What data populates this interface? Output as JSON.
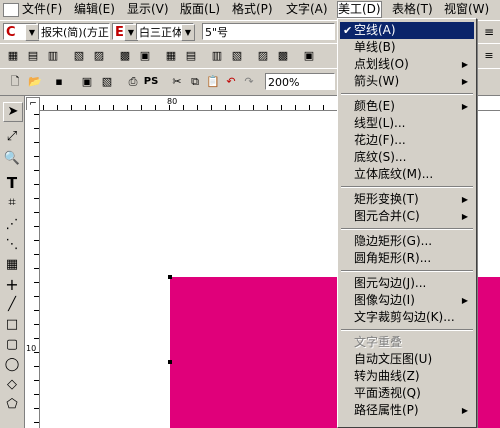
{
  "menubar": {
    "items": [
      {
        "label": "文件(F)"
      },
      {
        "label": "编辑(E)"
      },
      {
        "label": "显示(V)"
      },
      {
        "label": "版面(L)"
      },
      {
        "label": "格式(P)"
      },
      {
        "label": "文字(A)"
      },
      {
        "label": "美工(D)"
      },
      {
        "label": "表格(T)"
      },
      {
        "label": "视窗(W)"
      }
    ]
  },
  "format_toolbar": {
    "color_c": "C",
    "font_cn": "报宋(简)(方正)",
    "color_e": "E",
    "font_en": "白三正体",
    "font_size": "5\"号"
  },
  "std_toolbar": {
    "ps_label": "PS",
    "zoom": "200%"
  },
  "ruler": {
    "h_mark": "80",
    "v_mark": "10"
  },
  "colors": {
    "highlight": "#0a246a",
    "shape_fill": "#e0007a",
    "menu_bg": "#d4d0c8"
  },
  "dropdown": {
    "items": [
      {
        "label": "空线(A)",
        "checked": true,
        "selected": true
      },
      {
        "label": "单线(B)"
      },
      {
        "label": "点划线(O)",
        "submenu": true
      },
      {
        "label": "箭头(W)",
        "submenu": true
      },
      {
        "label": "颜色(E)",
        "submenu": true
      },
      {
        "label": "线型(L)..."
      },
      {
        "label": "花边(F)..."
      },
      {
        "label": "底纹(S)..."
      },
      {
        "label": "立体底纹(M)..."
      },
      {
        "label": "矩形变换(T)",
        "submenu": true
      },
      {
        "label": "图元合并(C)",
        "submenu": true
      },
      {
        "label": "隐边矩形(G)..."
      },
      {
        "label": "圆角矩形(R)..."
      },
      {
        "label": "图元勾边(J)..."
      },
      {
        "label": "图像勾边(I)",
        "submenu": true
      },
      {
        "label": "文字裁剪勾边(K)..."
      },
      {
        "label": "文字重叠",
        "disabled": true
      },
      {
        "label": "自动文压图(U)"
      },
      {
        "label": "转为曲线(Z)"
      },
      {
        "label": "平面透视(Q)"
      },
      {
        "label": "路径属性(P)",
        "submenu": true
      }
    ]
  }
}
